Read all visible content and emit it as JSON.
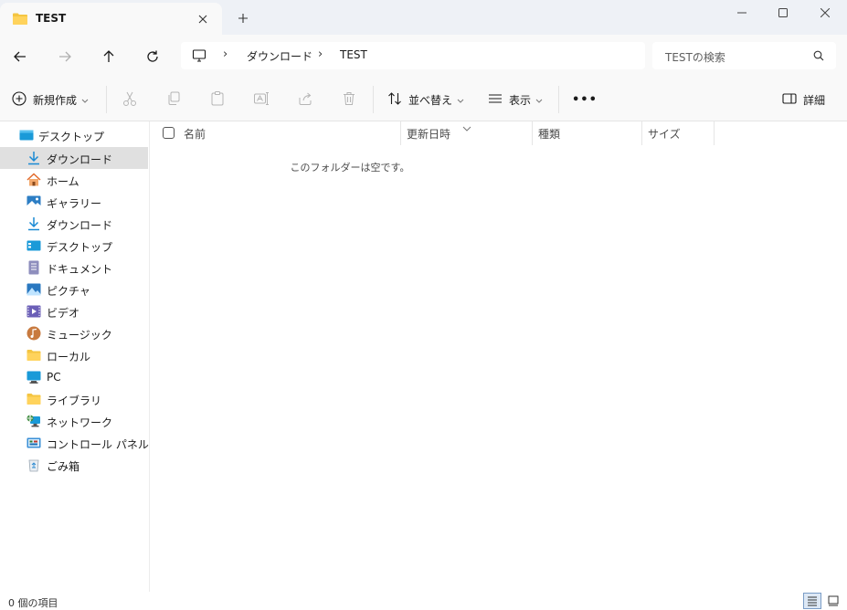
{
  "tab": {
    "title": "TEST",
    "icon": "folder-icon"
  },
  "address": {
    "crumbs": [
      "ダウンロード",
      "TEST"
    ],
    "search_placeholder": "TESTの検索"
  },
  "toolbar": {
    "new": "新規作成",
    "sort": "並べ替え",
    "view": "表示",
    "more": "•••",
    "details": "詳細"
  },
  "sidebar": {
    "items": [
      {
        "label": "デスクトップ",
        "icon": "desktop-icon"
      },
      {
        "label": "ダウンロード",
        "icon": "download-icon",
        "selected": true
      },
      {
        "label": "ホーム",
        "icon": "home-icon"
      },
      {
        "label": "ギャラリー",
        "icon": "gallery-icon"
      },
      {
        "label": "ダウンロード",
        "icon": "download-icon"
      },
      {
        "label": "デスクトップ",
        "icon": "desktop-icon"
      },
      {
        "label": "ドキュメント",
        "icon": "document-icon"
      },
      {
        "label": "ピクチャ",
        "icon": "pictures-icon"
      },
      {
        "label": "ビデオ",
        "icon": "video-icon"
      },
      {
        "label": "ミュージック",
        "icon": "music-icon"
      },
      {
        "label": "ローカル",
        "icon": "folder-icon"
      },
      {
        "label": "PC",
        "icon": "pc-icon"
      },
      {
        "label": "ライブラリ",
        "icon": "folder-icon"
      },
      {
        "label": "ネットワーク",
        "icon": "network-icon"
      },
      {
        "label": "コントロール パネル",
        "icon": "control-panel-icon"
      },
      {
        "label": "ごみ箱",
        "icon": "recycle-bin-icon"
      }
    ]
  },
  "columns": [
    "名前",
    "更新日時",
    "種類",
    "サイズ"
  ],
  "content": {
    "empty_message": "このフォルダーは空です。"
  },
  "status": {
    "item_count": "0 個の項目"
  },
  "colors": {
    "accent": "#0067c0",
    "folder": "#f4c542",
    "selected": "#e0e0e0"
  }
}
